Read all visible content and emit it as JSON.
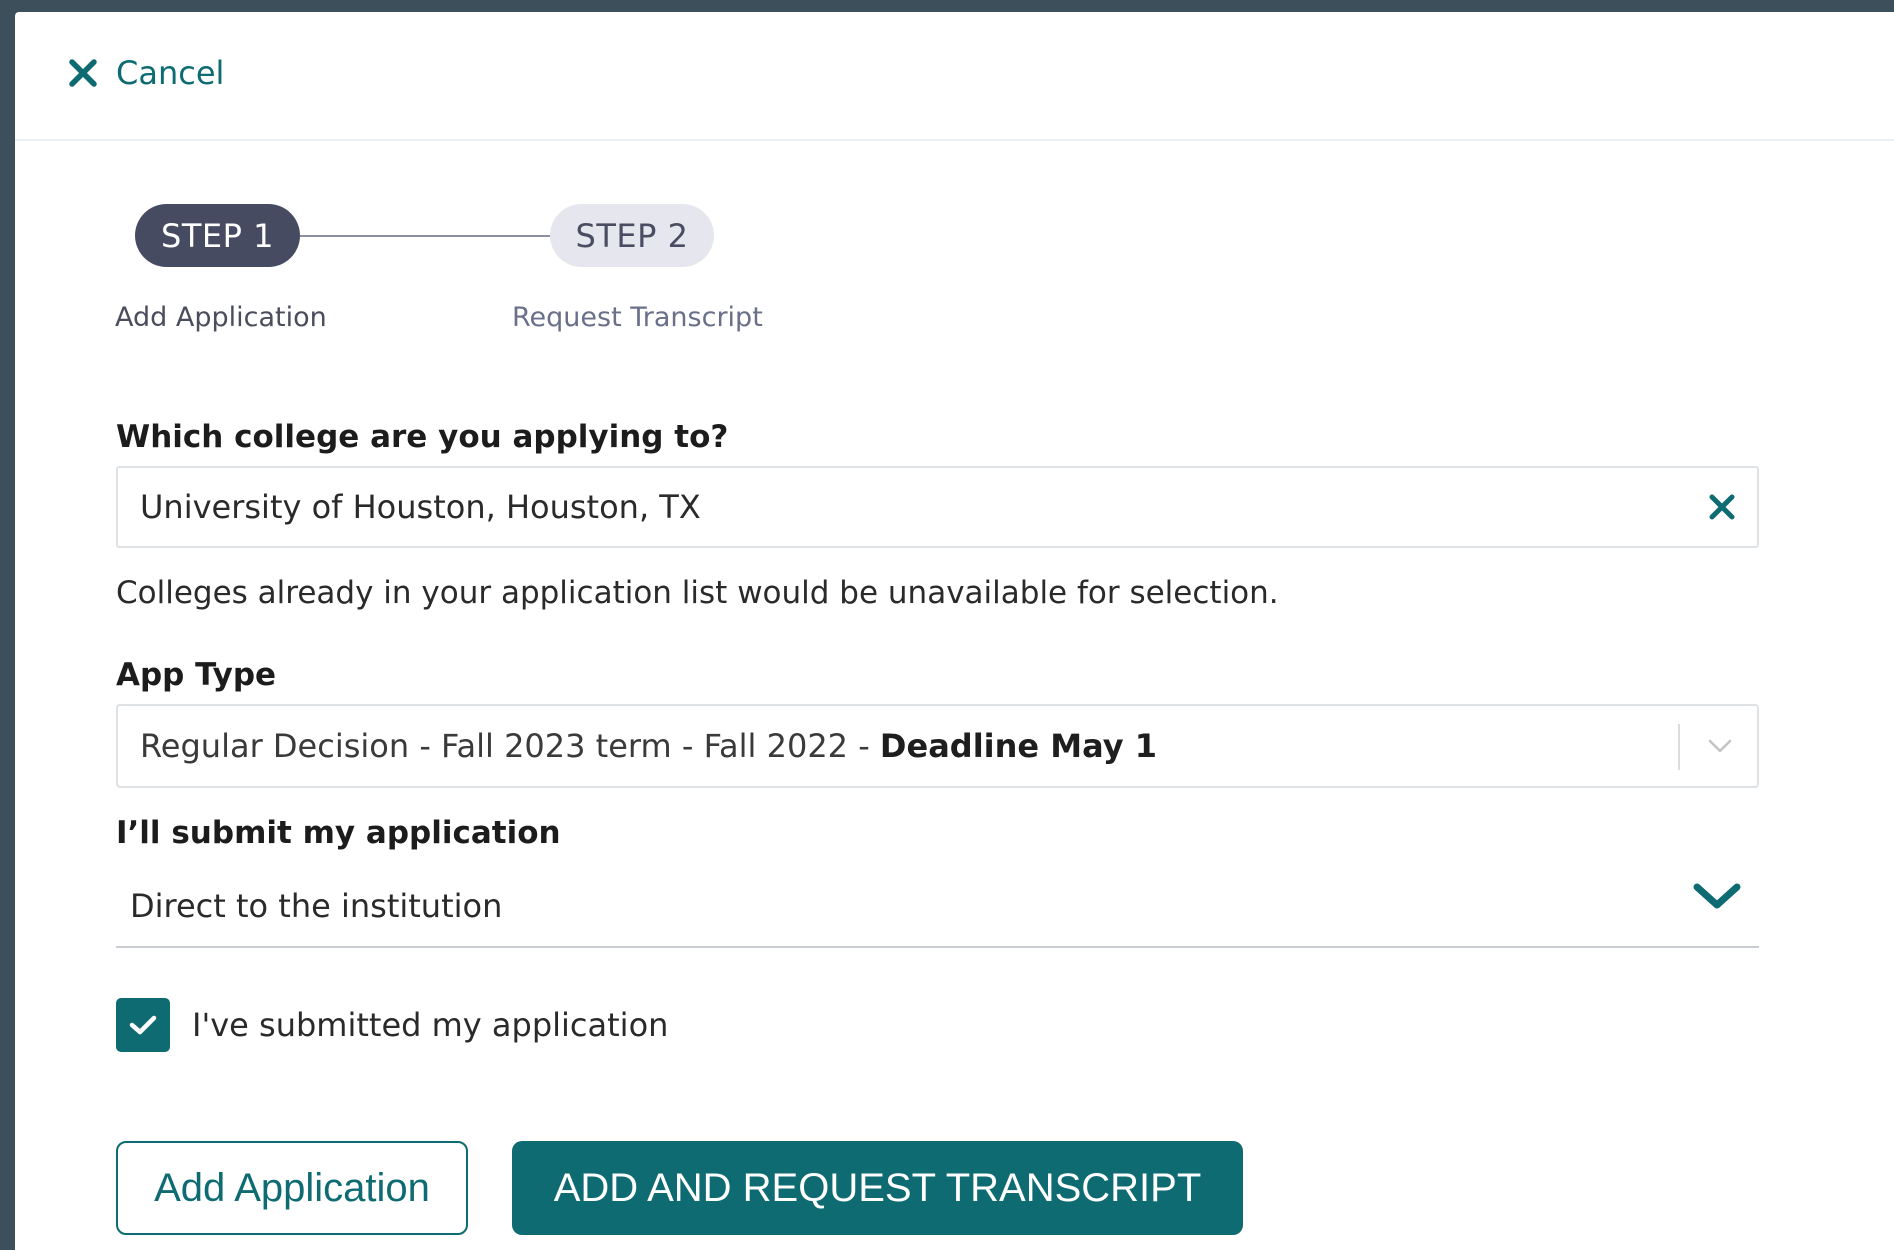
{
  "header": {
    "cancel_label": "Cancel",
    "cancel_icon": "close-icon"
  },
  "stepper": {
    "steps": [
      {
        "badge": "STEP 1",
        "label": "Add Application",
        "active": true
      },
      {
        "badge": "STEP 2",
        "label": "Request Transcript",
        "active": false
      }
    ]
  },
  "form": {
    "college": {
      "label": "Which college are you applying to?",
      "value": "University of Houston, Houston, TX",
      "clear_icon": "close-icon",
      "helper_text": "Colleges already in your application list would be unavailable for selection."
    },
    "app_type": {
      "label": "App Type",
      "value_prefix": "Regular Decision - Fall 2023 term - Fall 2022 - ",
      "value_deadline": "Deadline May 1",
      "icon": "chevron-down-icon"
    },
    "submission": {
      "label": "I’ll submit my application",
      "value": "Direct to the institution",
      "icon": "chevron-down-icon"
    },
    "submitted_checkbox": {
      "label": "I've submitted my application",
      "checked": true
    }
  },
  "actions": {
    "add_label": "Add Application",
    "add_request_label": "ADD AND REQUEST TRANSCRIPT"
  },
  "colors": {
    "accent": "#0e6b72",
    "step_active": "#474b61",
    "step_inactive": "#e6e7ee",
    "backdrop": "#3d4f5a"
  }
}
